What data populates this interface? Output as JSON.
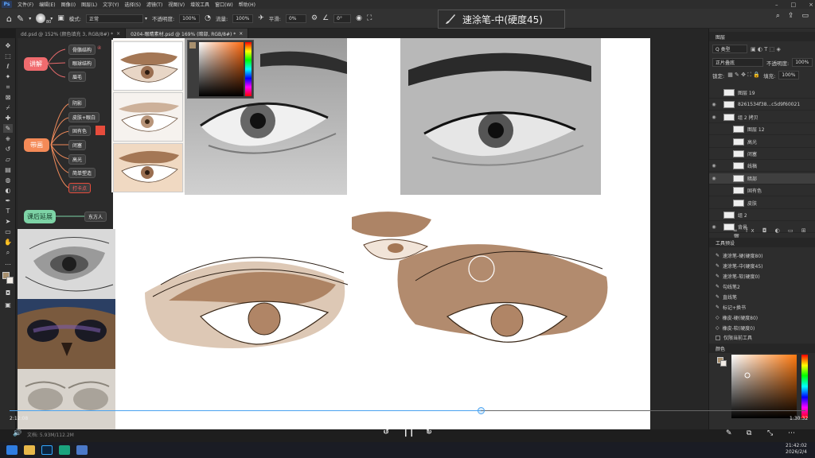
{
  "menubar": {
    "logo": "Ps",
    "items": [
      "文件(F)",
      "编辑(E)",
      "图像(I)",
      "图层(L)",
      "文字(Y)",
      "选择(S)",
      "滤镜(T)",
      "视图(V)",
      "增效工具",
      "窗口(W)",
      "帮助(H)"
    ],
    "window_controls": [
      "–",
      "□",
      "×"
    ]
  },
  "options_bar": {
    "brush_size": "80",
    "mode_label": "模式:",
    "mode_value": "正常",
    "opacity_label": "不透明度:",
    "opacity_value": "100%",
    "flow_label": "流量:",
    "flow_value": "100%",
    "smooth_label": "平滑:",
    "smooth_value": "0%",
    "angle_value": "0°"
  },
  "brush_overlay": {
    "text": "速涂笔-中(硬度45)"
  },
  "tabs": [
    {
      "label": "dd.psd @ 152% (颜色填充 3, RGB/8#) *",
      "active": false
    },
    {
      "label": "0204-眼睛素材.psd @ 169% (暗部, RGB/8#) *",
      "active": true
    }
  ],
  "mindmap": {
    "nodes": {
      "explain": "讲解",
      "paint": "带画",
      "extend": "课后延展"
    },
    "explain_children": [
      "骨骼结构",
      "眼球结构",
      "眉毛"
    ],
    "paint_children": [
      "阴影",
      "皮肤+眼白",
      "固有色",
      "闭塞",
      "高光",
      "简单塑造",
      "打卡点"
    ],
    "extend_child": "东方人",
    "marker": "④"
  },
  "layers_panel": {
    "title": "图层",
    "filter_label": "Q 类型",
    "blend_mode": "正片叠底",
    "opacity_label": "不透明度:",
    "opacity_value": "100%",
    "lock_label": "锁定:",
    "fill_label": "填充:",
    "fill_value": "100%",
    "layers": [
      {
        "name": "图层 19",
        "visible": false,
        "selected": false,
        "indent": 0
      },
      {
        "name": "8261534f38...c5d9f60021",
        "visible": true,
        "selected": false,
        "indent": 0
      },
      {
        "name": "组 2 拷贝",
        "visible": true,
        "selected": false,
        "indent": 0
      },
      {
        "name": "图层 12",
        "visible": false,
        "selected": false,
        "indent": 1
      },
      {
        "name": "高光",
        "visible": false,
        "selected": false,
        "indent": 1
      },
      {
        "name": "闭塞",
        "visible": false,
        "selected": false,
        "indent": 1
      },
      {
        "name": "线稿",
        "visible": true,
        "selected": false,
        "indent": 1
      },
      {
        "name": "暗部",
        "visible": true,
        "selected": true,
        "indent": 1
      },
      {
        "name": "固有色",
        "visible": false,
        "selected": false,
        "indent": 1
      },
      {
        "name": "皮肤",
        "visible": false,
        "selected": false,
        "indent": 1
      },
      {
        "name": "组 2",
        "visible": false,
        "selected": false,
        "indent": 0
      },
      {
        "name": "背景",
        "visible": true,
        "selected": false,
        "indent": 0
      }
    ]
  },
  "tool_presets_panel": {
    "title": "工具预设",
    "items": [
      "速涂笔-硬(硬度80)",
      "速涂笔-中(硬度45)",
      "速涂笔-软(硬度0)",
      "勾线笔2",
      "直线笔",
      "标记+换书",
      "橡皮-硬(硬度80)",
      "橡皮-软(硬度0)"
    ],
    "current_only_label": "仅限当前工具"
  },
  "color_panel": {
    "title": "颜色"
  },
  "player": {
    "elapsed": "2:12:08",
    "total": "1:30:32",
    "progress": 0.592,
    "skip_back": "10",
    "skip_forward": "30",
    "pause_icon": "❙❙"
  },
  "status": {
    "text": "文档: 5.93M/112.2M"
  },
  "clock": {
    "time": "21:42:02",
    "date": "2026/2/4"
  },
  "colors": {
    "accent_blue": "#4aa3f0",
    "skin_brown": "#a47755",
    "node_red": "#f06b6e",
    "node_orange": "#f48a57",
    "node_green": "#7dd3a6"
  }
}
